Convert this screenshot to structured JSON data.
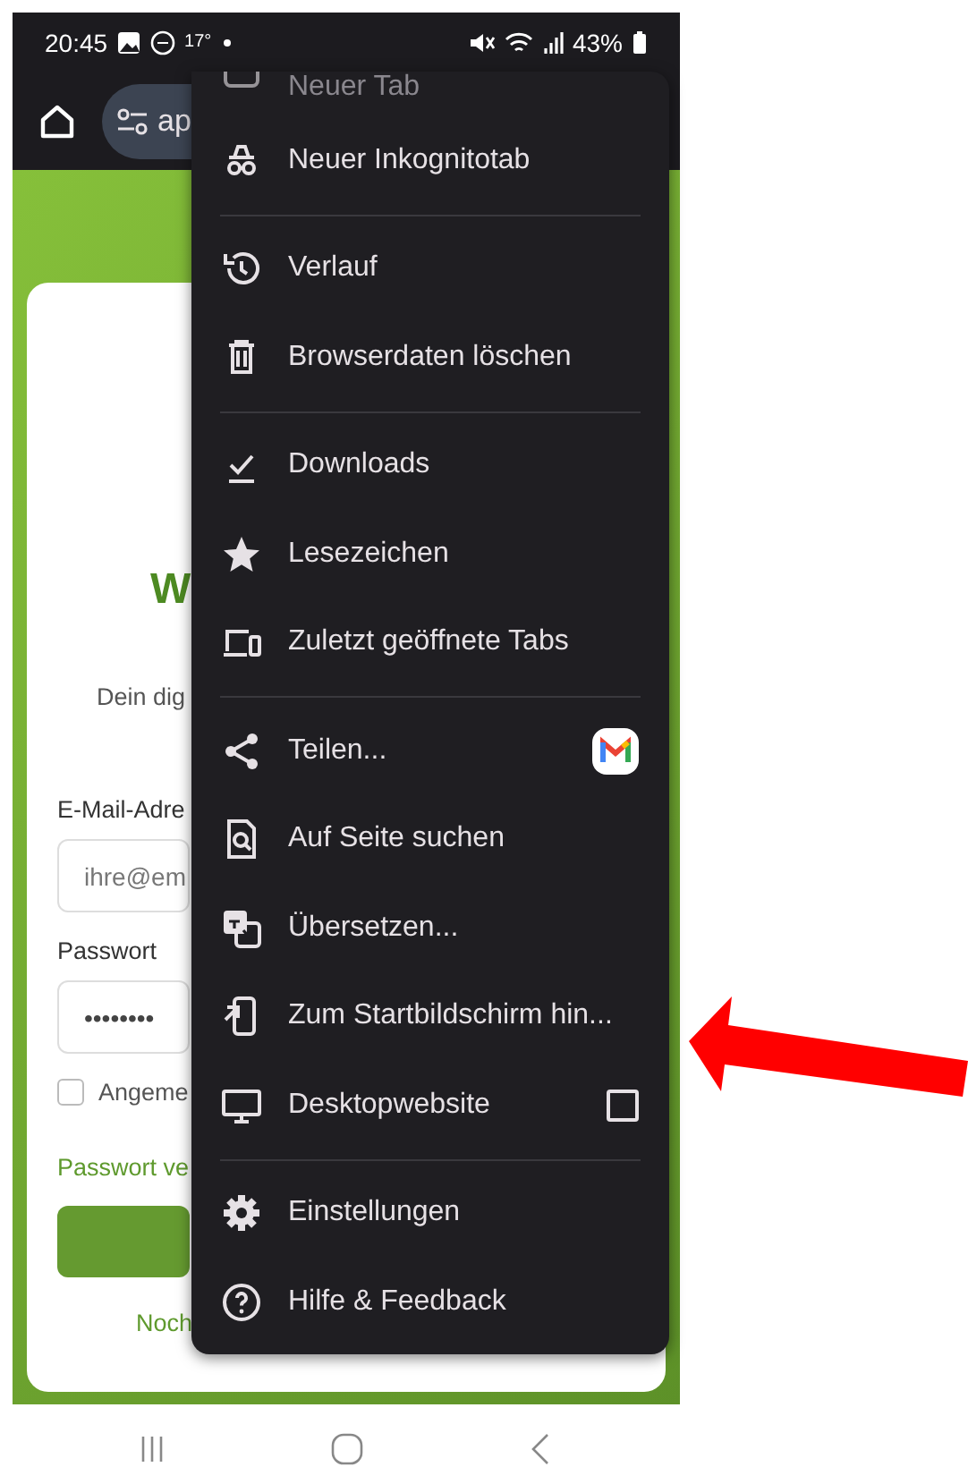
{
  "status_bar": {
    "time": "20:45",
    "temperature": "17°",
    "battery": "43%"
  },
  "toolbar": {
    "url": "ap"
  },
  "login_card": {
    "heading": "W",
    "subtitle": "Dein dig",
    "email_label": "E-Mail-Adre",
    "email_placeholder": "ihre@em",
    "password_label": "Passwort",
    "password_value": "••••••••",
    "remember": {
      "label": "Angeme",
      "checked": false
    },
    "forgot_link": "Passwort ve",
    "register_text": "Noch"
  },
  "menu": {
    "sections": [
      {
        "items": [
          {
            "label": "Neuer Tab",
            "kind": "plain"
          },
          {
            "label": "Neuer Inkognitotab",
            "kind": "plain"
          }
        ]
      },
      {
        "items": [
          {
            "label": "Verlauf",
            "kind": "plain"
          },
          {
            "label": "Browserdaten löschen",
            "kind": "plain"
          }
        ]
      },
      {
        "items": [
          {
            "label": "Downloads",
            "kind": "plain"
          },
          {
            "label": "Lesezeichen",
            "kind": "plain"
          },
          {
            "label": "Zuletzt geöffnete Tabs",
            "kind": "plain"
          }
        ]
      },
      {
        "items": [
          {
            "label": "Teilen...",
            "kind": "share"
          },
          {
            "label": "Auf Seite suchen",
            "kind": "plain"
          },
          {
            "label": "Übersetzen...",
            "kind": "plain"
          },
          {
            "label": "Zum Startbildschirm hin...",
            "kind": "plain"
          },
          {
            "label": "Desktopwebsite",
            "kind": "checkbox",
            "checked": false
          }
        ]
      },
      {
        "items": [
          {
            "label": "Einstellungen",
            "kind": "plain"
          },
          {
            "label": "Hilfe & Feedback",
            "kind": "plain"
          }
        ]
      }
    ]
  }
}
